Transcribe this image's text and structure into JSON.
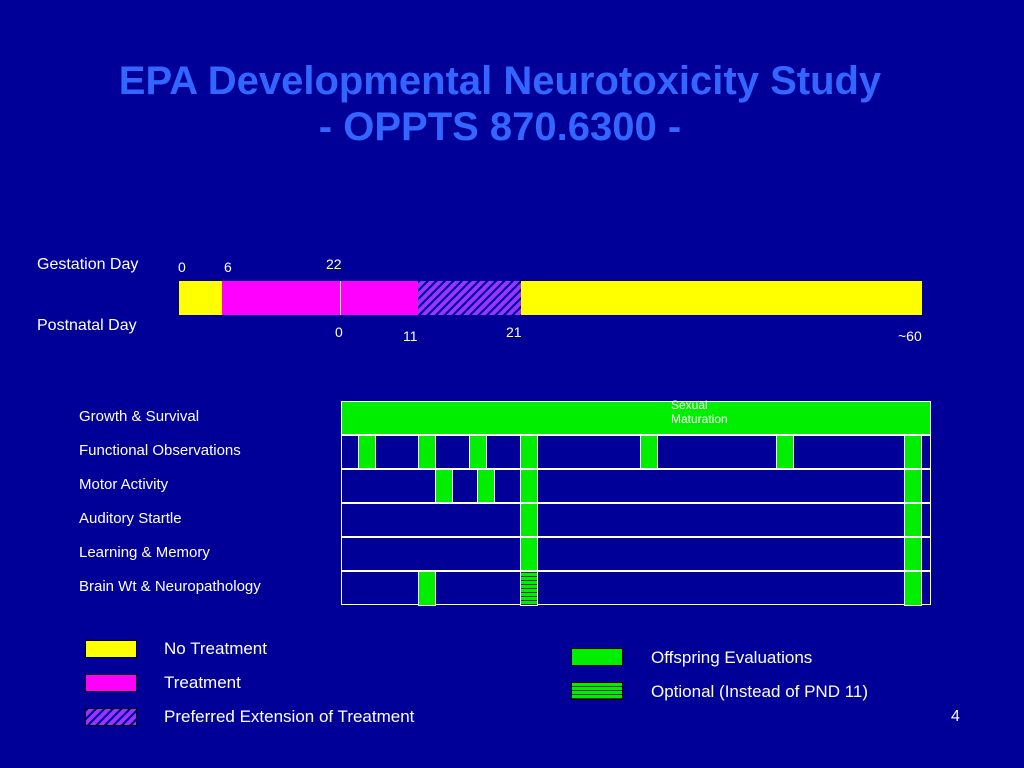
{
  "title": {
    "line1": "EPA Developmental Neurotoxicity Study",
    "line2": "- OPPTS 870.6300 -"
  },
  "timeline": {
    "gestation_label": "Gestation Day",
    "postnatal_label": "Postnatal Day",
    "gestation_ticks": [
      "0",
      "6",
      "22"
    ],
    "postnatal_ticks": [
      "0",
      "11",
      "21",
      "~60"
    ]
  },
  "evaluations": {
    "rows": [
      "Growth & Survival",
      "Functional Observations",
      "Motor Activity",
      "Auditory Startle",
      "Learning & Memory",
      "Brain Wt & Neuropathology"
    ],
    "sexual_maturation": "Sexual Maturation"
  },
  "legend": {
    "no_treatment": "No Treatment",
    "treatment": "Treatment",
    "preferred_extension": "Preferred Extension of Treatment",
    "offspring_evaluations": "Offspring Evaluations",
    "optional": "Optional (Instead of PND 11)"
  },
  "colors": {
    "background": "#000099",
    "title": "#3366ff",
    "no_treatment": "#ffff00",
    "treatment": "#ff00ff",
    "evaluation": "#00ee00"
  },
  "page_number": "4"
}
